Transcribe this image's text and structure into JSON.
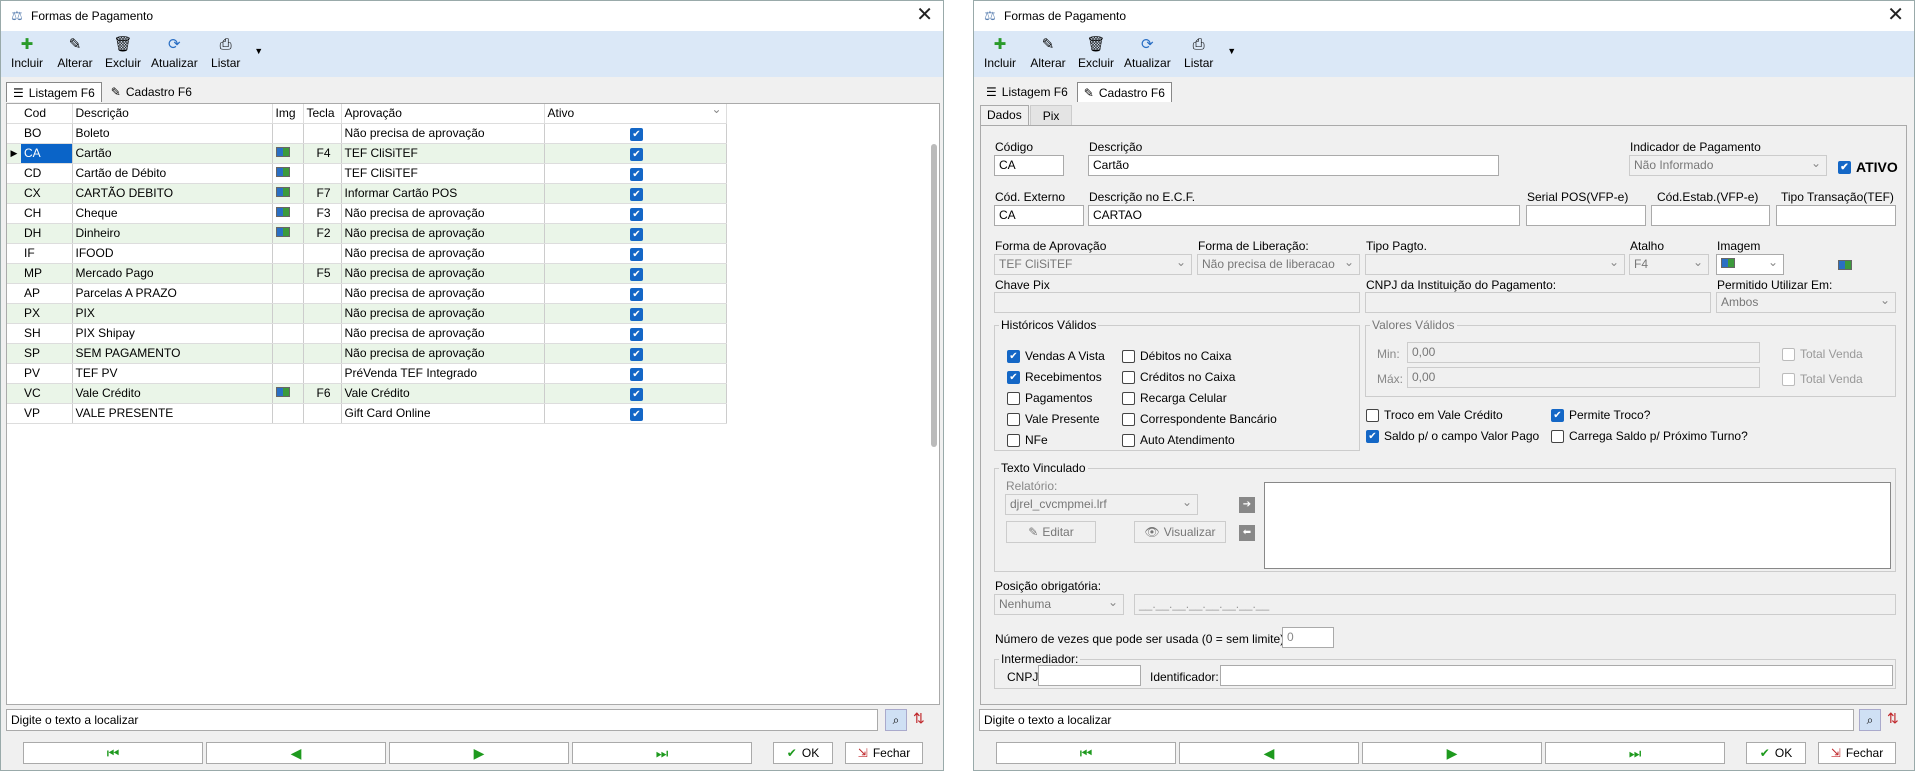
{
  "window_title": "Formas de Pagamento",
  "toolbar": {
    "incluir": "Incluir",
    "alterar": "Alterar",
    "excluir": "Excluir",
    "atualizar": "Atualizar",
    "listar": "Listar"
  },
  "tabs": {
    "listagem": "Listagem F6",
    "cadastro": "Cadastro F6"
  },
  "grid": {
    "headers": [
      "Cod",
      "Descrição",
      "Img",
      "Tecla",
      "Aprovação",
      "Ativo"
    ],
    "rows": [
      {
        "cod": "BO",
        "desc": "Boleto",
        "img": false,
        "tecla": "",
        "aprov": "Não precisa de aprovação"
      },
      {
        "cod": "CA",
        "desc": "Cartão",
        "img": true,
        "tecla": "F4",
        "aprov": "TEF CliSiTEF"
      },
      {
        "cod": "CD",
        "desc": "Cartão de Débito",
        "img": true,
        "tecla": "",
        "aprov": "TEF CliSiTEF"
      },
      {
        "cod": "CX",
        "desc": "CARTÃO DEBITO",
        "img": true,
        "tecla": "F7",
        "aprov": "Informar Cartão POS"
      },
      {
        "cod": "CH",
        "desc": "Cheque",
        "img": true,
        "tecla": "F3",
        "aprov": "Não precisa de aprovação"
      },
      {
        "cod": "DH",
        "desc": "Dinheiro",
        "img": true,
        "tecla": "F2",
        "aprov": "Não precisa de aprovação"
      },
      {
        "cod": "IF",
        "desc": "IFOOD",
        "img": false,
        "tecla": "",
        "aprov": "Não precisa de aprovação"
      },
      {
        "cod": "MP",
        "desc": "Mercado Pago",
        "img": false,
        "tecla": "F5",
        "aprov": "Não precisa de aprovação"
      },
      {
        "cod": "AP",
        "desc": "Parcelas A PRAZO",
        "img": false,
        "tecla": "",
        "aprov": "Não precisa de aprovação"
      },
      {
        "cod": "PX",
        "desc": "PIX",
        "img": false,
        "tecla": "",
        "aprov": "Não precisa de aprovação"
      },
      {
        "cod": "SH",
        "desc": "PIX Shipay",
        "img": false,
        "tecla": "",
        "aprov": "Não precisa de aprovação"
      },
      {
        "cod": "SP",
        "desc": "SEM PAGAMENTO",
        "img": false,
        "tecla": "",
        "aprov": "Não precisa de aprovação"
      },
      {
        "cod": "PV",
        "desc": "TEF PV",
        "img": false,
        "tecla": "",
        "aprov": "PréVenda TEF Integrado"
      },
      {
        "cod": "VC",
        "desc": "Vale Crédito",
        "img": true,
        "tecla": "F6",
        "aprov": "Vale Crédito"
      },
      {
        "cod": "VP",
        "desc": "VALE PRESENTE",
        "img": false,
        "tecla": "",
        "aprov": "Gift Card Online"
      }
    ]
  },
  "search_placeholder": "Digite o texto a localizar",
  "buttons": {
    "ok": "OK",
    "fechar": "Fechar"
  },
  "form": {
    "subtabs": {
      "dados": "Dados",
      "pix": "Pix"
    },
    "codigo_label": "Código",
    "codigo": "CA",
    "descricao_label": "Descrição",
    "descricao": "Cartão",
    "indicador_label": "Indicador de Pagamento",
    "indicador": "Não Informado",
    "ativo": "ATIVO",
    "cod_externo_label": "Cód. Externo",
    "cod_externo": "CA",
    "desc_ecf_label": "Descrição no E.C.F.",
    "desc_ecf": "CARTAO",
    "serial_pos_label": "Serial POS(VFP-e)",
    "cod_estab_label": "Cód.Estab.(VFP-e)",
    "tipo_transacao_label": "Tipo Transação(TEF)",
    "forma_aprov_label": "Forma de Aprovação",
    "forma_aprov": "TEF CliSiTEF",
    "forma_lib_label": "Forma de Liberação:",
    "forma_lib": "Não precisa de liberacao",
    "tipo_pagto_label": "Tipo Pagto.",
    "atalho_label": "Atalho",
    "atalho": "F4",
    "imagem_label": "Imagem",
    "chave_pix_label": "Chave Pix",
    "cnpj_inst_label": "CNPJ da Instituição do Pagamento:",
    "permitido_label": "Permitido Utilizar Em:",
    "permitido": "Ambos",
    "historicos_label": "Históricos Válidos",
    "historicos": [
      {
        "label": "Vendas A Vista",
        "on": true
      },
      {
        "label": "Recebimentos",
        "on": true
      },
      {
        "label": "Pagamentos",
        "on": false
      },
      {
        "label": "Vale Presente",
        "on": false
      },
      {
        "label": "NFe",
        "on": false
      },
      {
        "label": "Débitos no Caixa",
        "on": false
      },
      {
        "label": "Créditos no Caixa",
        "on": false
      },
      {
        "label": "Recarga Celular",
        "on": false
      },
      {
        "label": "Correspondente Bancário",
        "on": false
      },
      {
        "label": "Auto Atendimento",
        "on": false
      }
    ],
    "valores_label": "Valores Válidos",
    "min_label": "Min:",
    "min": "0,00",
    "max_label": "Máx:",
    "max": "0,00",
    "total_venda": "Total Venda",
    "troco_vale": "Troco em Vale Crédito",
    "permite_troco": "Permite Troco?",
    "saldo_valor_pago": "Saldo p/ o campo Valor Pago",
    "carrega_saldo": "Carrega Saldo p/ Próximo Turno?",
    "texto_vinculado_label": "Texto Vinculado",
    "relatorio_label": "Relatório:",
    "relatorio": "djrel_cvcmpmei.lrf",
    "editar": "Editar",
    "visualizar": "Visualizar",
    "posicao_label": "Posição obrigatória:",
    "posicao": "Nenhuma",
    "posicao_mask": "__.__.__.__.__.__.__.__",
    "numero_vezes_label": "Número de vezes que pode ser usada (0 = sem limite):",
    "numero_vezes": "0",
    "intermediador_label": "Intermediador:",
    "cnpj_label": "CNPJ:",
    "identificador_label": "Identificador:"
  }
}
